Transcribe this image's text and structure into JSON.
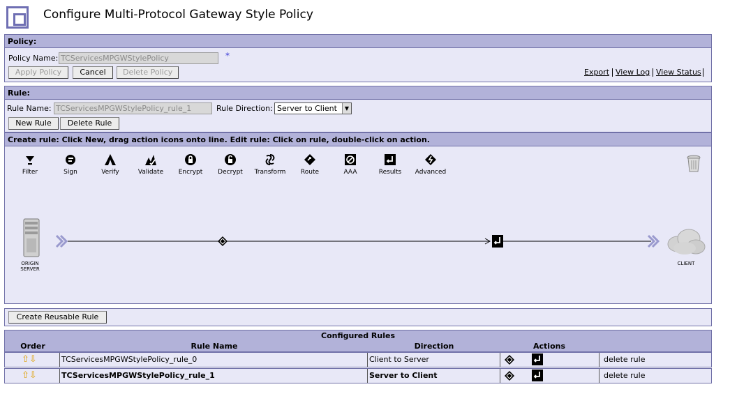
{
  "page": {
    "title": "Configure Multi-Protocol Gateway Style Policy"
  },
  "policy": {
    "header": "Policy:",
    "name_label": "Policy Name:",
    "name_value": "TCServicesMPGWStylePolicy",
    "required_marker": "*",
    "apply_label": "Apply Policy",
    "cancel_label": "Cancel",
    "delete_label": "Delete Policy",
    "links": {
      "export": "Export",
      "view_log": "View Log",
      "view_status": "View Status"
    }
  },
  "rule": {
    "header": "Rule:",
    "name_label": "Rule Name:",
    "name_value": "TCServicesMPGWStylePolicy_rule_1",
    "direction_label": "Rule Direction:",
    "direction_value": "Server to Client",
    "new_label": "New Rule",
    "delete_label": "Delete Rule"
  },
  "editor": {
    "instructions": "Create rule: Click New, drag action icons onto line.   Edit rule: Click on rule, double-click on action.",
    "actions": [
      "Filter",
      "Sign",
      "Verify",
      "Validate",
      "Encrypt",
      "Decrypt",
      "Transform",
      "Route",
      "AAA",
      "Results",
      "Advanced"
    ],
    "origin_label_1": "ORIGIN",
    "origin_label_2": "SERVER",
    "client_label": "CLIENT"
  },
  "reusable": {
    "button_label": "Create Reusable Rule"
  },
  "configured": {
    "title": "Configured Rules",
    "columns": {
      "order": "Order",
      "name": "Rule Name",
      "direction": "Direction",
      "actions": "Actions"
    },
    "rows": [
      {
        "name": "TCServicesMPGWStylePolicy_rule_0",
        "direction": "Client to Server",
        "delete": "delete rule"
      },
      {
        "name": "TCServicesMPGWStylePolicy_rule_1",
        "direction": "Server to Client",
        "delete": "delete rule"
      }
    ]
  }
}
